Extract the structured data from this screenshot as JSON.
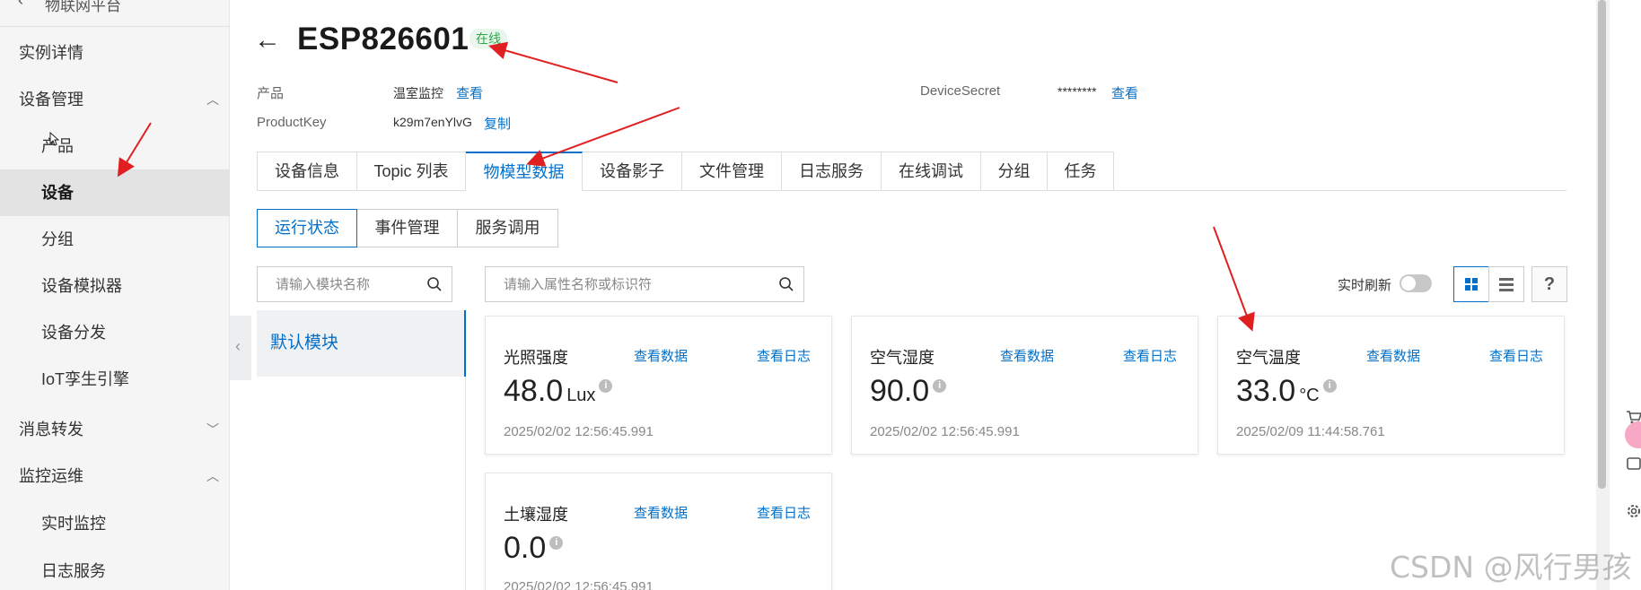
{
  "sidebar": {
    "top_title": "物联网平台",
    "items": [
      {
        "label": "实例详情"
      },
      {
        "label": "设备管理",
        "chevron": "up"
      },
      {
        "label": "产品"
      },
      {
        "label": "设备"
      },
      {
        "label": "分组"
      },
      {
        "label": "设备模拟器"
      },
      {
        "label": "设备分发"
      },
      {
        "label": "IoT孪生引擎"
      },
      {
        "label": "消息转发",
        "chevron": "down"
      },
      {
        "label": "监控运维",
        "chevron": "up"
      },
      {
        "label": "实时监控"
      },
      {
        "label": "日志服务"
      }
    ]
  },
  "header": {
    "device_name": "ESP826601",
    "status": "在线",
    "product_label": "产品",
    "product_value": "温室监控",
    "product_link": "查看",
    "productkey_label": "ProductKey",
    "productkey_value": "k29m7enYlvG",
    "productkey_link": "复制",
    "devicesecret_label": "DeviceSecret",
    "devicesecret_value": "********",
    "devicesecret_link": "查看"
  },
  "tabs": [
    {
      "label": "设备信息"
    },
    {
      "label": "Topic 列表"
    },
    {
      "label": "物模型数据",
      "active": true
    },
    {
      "label": "设备影子"
    },
    {
      "label": "文件管理"
    },
    {
      "label": "日志服务"
    },
    {
      "label": "在线调试"
    },
    {
      "label": "分组"
    },
    {
      "label": "任务"
    }
  ],
  "subtabs": [
    {
      "label": "运行状态",
      "active": true
    },
    {
      "label": "事件管理"
    },
    {
      "label": "服务调用"
    }
  ],
  "module_search": {
    "placeholder": "请输入模块名称"
  },
  "property_search": {
    "placeholder": "请输入属性名称或标识符"
  },
  "modules": [
    {
      "label": "默认模块"
    }
  ],
  "toolbar": {
    "realtime_label": "实时刷新",
    "realtime_on": false,
    "view": "grid",
    "help": "?"
  },
  "properties": [
    {
      "name": "光照强度",
      "value": "48.0",
      "unit": "Lux",
      "timestamp": "2025/02/02 12:56:45.991",
      "data_link": "查看数据",
      "log_link": "查看日志"
    },
    {
      "name": "空气湿度",
      "value": "90.0",
      "unit": "",
      "timestamp": "2025/02/02 12:56:45.991",
      "data_link": "查看数据",
      "log_link": "查看日志"
    },
    {
      "name": "空气温度",
      "value": "33.0",
      "unit": "°C",
      "timestamp": "2025/02/09 11:44:58.761",
      "data_link": "查看数据",
      "log_link": "查看日志"
    },
    {
      "name": "土壤湿度",
      "value": "0.0",
      "unit": "",
      "timestamp": "2025/02/02 12:56:45.991",
      "data_link": "查看数据",
      "log_link": "查看日志"
    }
  ],
  "watermark": "CSDN @风行男孩",
  "colors": {
    "accent": "#0070cc",
    "online": "#2fa64b",
    "annotation": "#e02020"
  }
}
